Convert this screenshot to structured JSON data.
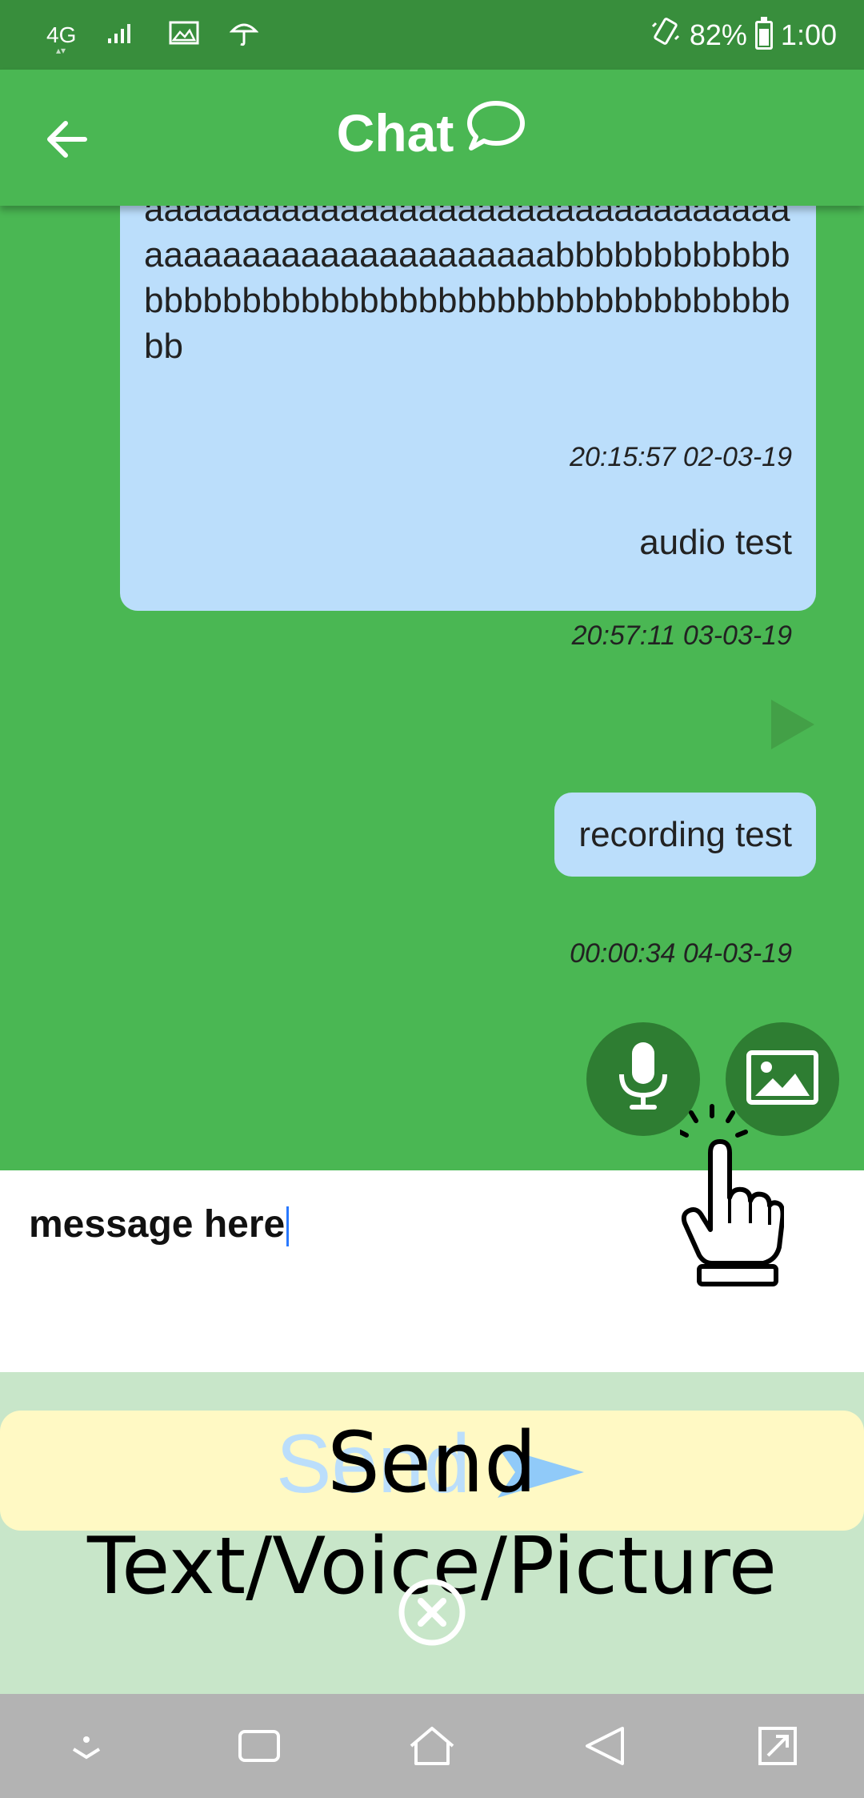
{
  "status_bar": {
    "network": "4G",
    "battery": "82%",
    "battery_level": 0.82,
    "time": "1:00"
  },
  "header": {
    "title": "Chat",
    "back_icon": "arrow-left-icon",
    "title_icon": "chat-bubble-icon"
  },
  "messages": [
    {
      "text": "aaaaaaaaaaaaaaaaaaaaaaaaaaaaaaaaaaaaaaaaaaaaaaaaaaaaaabbbbbbbbbbbbbbbbbbbbbbbbbbbbbbbbbbbbbbbbbbbbbbb",
      "time": "20:15:57 02-03-19"
    },
    {
      "text": "audio test",
      "time": "20:57:11 03-03-19"
    },
    {
      "text": "recording test",
      "time": "00:00:34 04-03-19"
    }
  ],
  "actions": {
    "mic_icon": "microphone-icon",
    "image_icon": "image-icon",
    "play_icon": "play-icon"
  },
  "input": {
    "value": "message here"
  },
  "send": {
    "ghost_label": "Send",
    "label": "Send",
    "subtitle": "Text/Voice/Picture",
    "close_icon": "close-circle-icon"
  },
  "colors": {
    "primary": "#4ab753",
    "status_bar": "#388e3c",
    "bubble": "#bbdefb",
    "fab": "#2e7d32",
    "send_button": "#fff9c4",
    "send_panel": "#c8e6c9",
    "nav_bar": "#b3b3b3"
  }
}
